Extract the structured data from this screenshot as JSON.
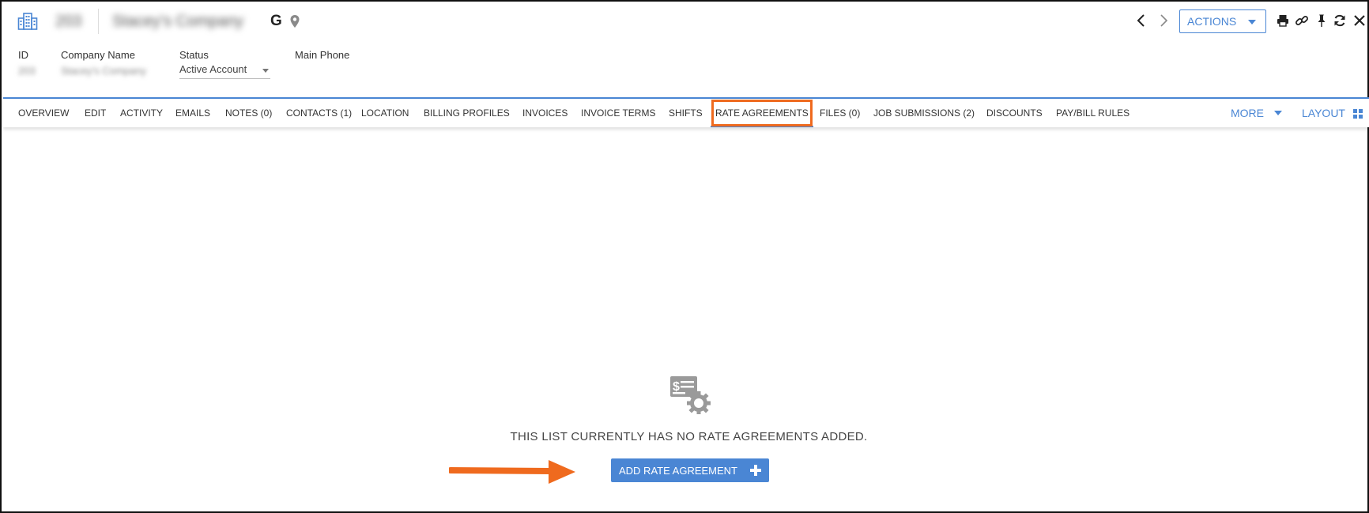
{
  "header": {
    "record_id": "203",
    "company_title": "Stacey's Company",
    "google_glyph": "G",
    "actions_label": "ACTIONS"
  },
  "fields": {
    "id_label": "ID",
    "id_value": "203",
    "name_label": "Company Name",
    "name_value": "Stacey's Company",
    "status_label": "Status",
    "status_value": "Active Account",
    "phone_label": "Main Phone"
  },
  "tabs": [
    {
      "label": "OVERVIEW"
    },
    {
      "label": "EDIT"
    },
    {
      "label": "ACTIVITY"
    },
    {
      "label": "EMAILS"
    },
    {
      "label": "NOTES (0)"
    },
    {
      "label": "CONTACTS (1)"
    },
    {
      "label": "LOCATION"
    },
    {
      "label": "BILLING PROFILES"
    },
    {
      "label": "INVOICES"
    },
    {
      "label": "INVOICE TERMS"
    },
    {
      "label": "SHIFTS"
    },
    {
      "label": "RATE AGREEMENTS"
    },
    {
      "label": "FILES (0)"
    },
    {
      "label": "JOB SUBMISSIONS (2)"
    },
    {
      "label": "DISCOUNTS"
    },
    {
      "label": "PAY/BILL RULES"
    }
  ],
  "tabs_right": {
    "more_label": "MORE",
    "layout_label": "LAYOUT"
  },
  "empty_state": {
    "message": "THIS LIST CURRENTLY HAS NO RATE AGREEMENTS ADDED.",
    "add_label": "ADD RATE AGREEMENT"
  },
  "colors": {
    "accent": "#4a86d4",
    "annotation": "#ef6a1e",
    "icon_gray": "#9a9a9a"
  },
  "icons": [
    "company-building-icon",
    "google-icon",
    "map-pin-icon",
    "chevron-left-icon",
    "chevron-right-icon",
    "print-icon",
    "link-icon",
    "pin-icon",
    "refresh-icon",
    "close-icon",
    "layout-grid-icon",
    "rate-agreement-icon",
    "plus-icon"
  ]
}
